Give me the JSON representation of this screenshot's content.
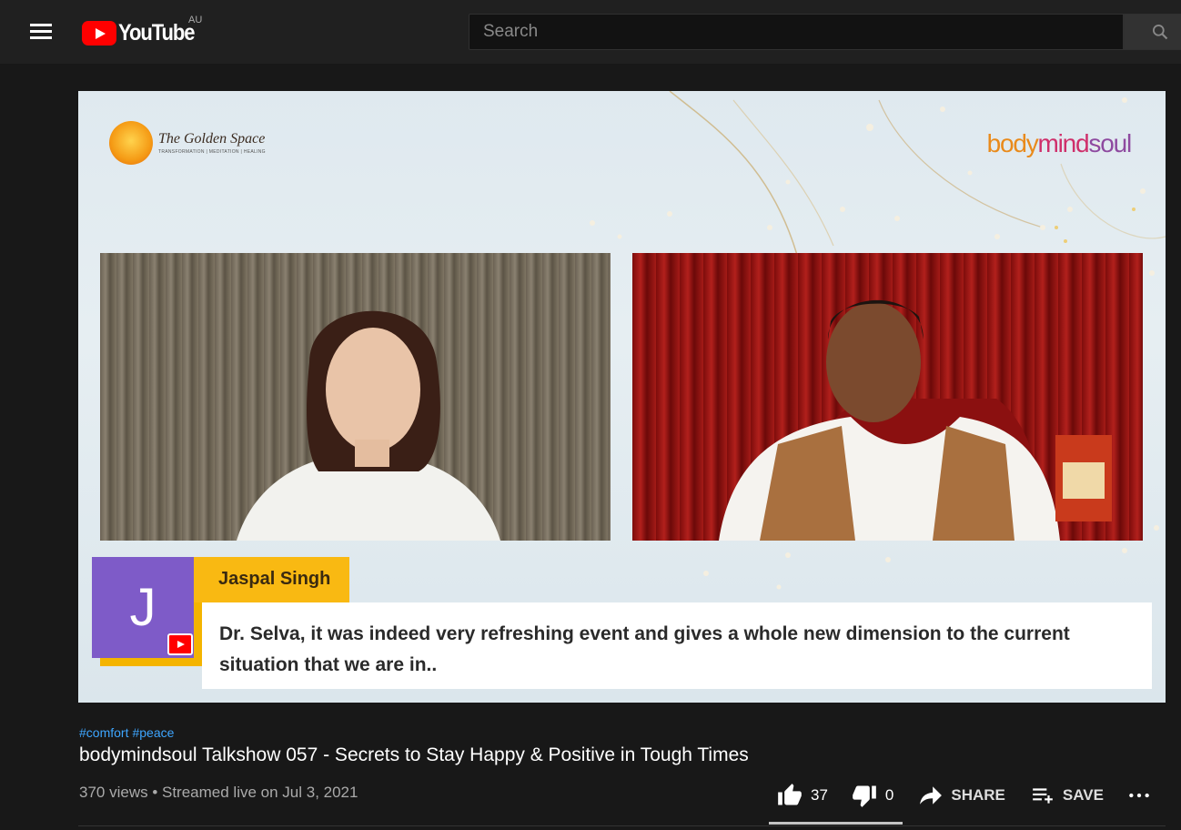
{
  "masthead": {
    "logo_text": "YouTube",
    "region": "AU",
    "search_placeholder": "Search"
  },
  "video": {
    "overlay_logo_left": "The Golden Space",
    "overlay_logo_left_sub": "TRANSFORMATION | MEDITATION | HEALING",
    "overlay_logo_right_parts": [
      "body",
      "mind",
      "soul"
    ],
    "comment_initial": "J",
    "comment_author": "Jaspal Singh",
    "comment_text": "Dr. Selva, it was indeed very refreshing event and gives a whole new dimension to the current situation that we are in.."
  },
  "info": {
    "hashtags": [
      "#comfort",
      "#peace"
    ],
    "title": "bodymindsoul Talkshow 057 - Secrets to Stay Happy & Positive in Tough Times",
    "meta": "370 views • Streamed live on Jul 3, 2021",
    "likes": "37",
    "dislikes": "0",
    "share_label": "SHARE",
    "save_label": "SAVE"
  }
}
